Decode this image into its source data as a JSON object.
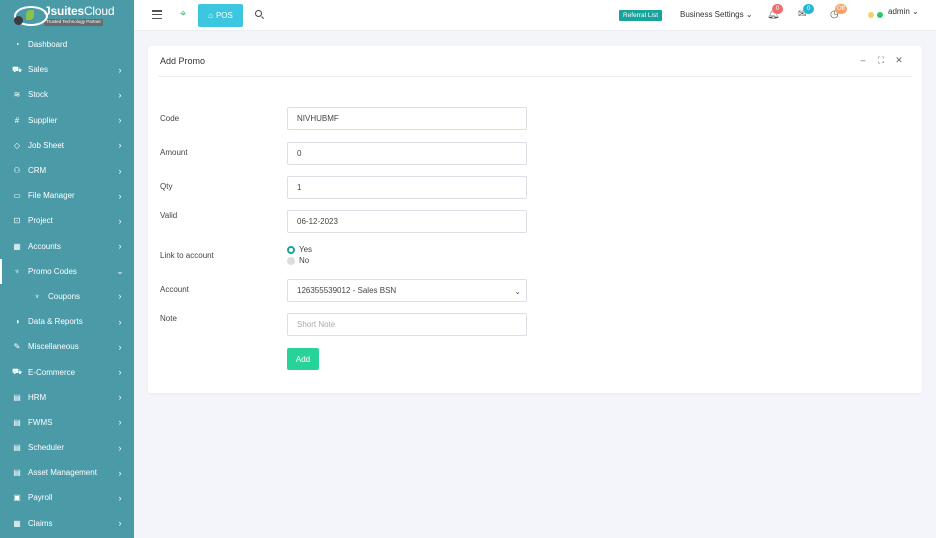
{
  "brand": {
    "name_bold": "Jsuites",
    "name_rest": "Cloud",
    "tagline": "Trusted Technology Partner"
  },
  "sidebar": {
    "items": [
      {
        "label": "Dashboard",
        "icon": "dashboard-icon",
        "has_chevron": false
      },
      {
        "label": "Sales",
        "icon": "cart-icon",
        "has_chevron": true
      },
      {
        "label": "Stock",
        "icon": "layers-icon",
        "has_chevron": true
      },
      {
        "label": "Supplier",
        "icon": "hash-icon",
        "has_chevron": true
      },
      {
        "label": "Job Sheet",
        "icon": "diamond-icon",
        "has_chevron": true
      },
      {
        "label": "CRM",
        "icon": "users-icon",
        "has_chevron": true
      },
      {
        "label": "File Manager",
        "icon": "folder-icon",
        "has_chevron": true
      },
      {
        "label": "Project",
        "icon": "briefcase-icon",
        "has_chevron": true
      },
      {
        "label": "Accounts",
        "icon": "calculator-icon",
        "has_chevron": true
      },
      {
        "label": "Promo Codes",
        "icon": "trophy-icon",
        "has_chevron": true,
        "expanded": true
      },
      {
        "label": "Coupons",
        "icon": "trophy-icon",
        "has_chevron": true,
        "sub": true
      },
      {
        "label": "Data & Reports",
        "icon": "pie-chart-icon",
        "has_chevron": true
      },
      {
        "label": "Miscellaneous",
        "icon": "edit-icon",
        "has_chevron": true
      },
      {
        "label": "E-Commerce",
        "icon": "cart-icon",
        "has_chevron": true
      },
      {
        "label": "HRM",
        "icon": "file-icon",
        "has_chevron": true
      },
      {
        "label": "FWMS",
        "icon": "file-icon",
        "has_chevron": true
      },
      {
        "label": "Scheduler",
        "icon": "file-icon",
        "has_chevron": true
      },
      {
        "label": "Asset Management",
        "icon": "file-icon",
        "has_chevron": true
      },
      {
        "label": "Payroll",
        "icon": "money-icon",
        "has_chevron": true
      },
      {
        "label": "Claims",
        "icon": "calculator-icon",
        "has_chevron": true
      }
    ]
  },
  "topbar": {
    "pos_label": "POS",
    "referral_label": "Referral List",
    "business_label": "Business Settings",
    "notifications_count": "0",
    "messages_count": "0",
    "clock_badge": "Off",
    "user_name": "admin"
  },
  "card": {
    "title": "Add Promo",
    "fields": {
      "code": {
        "label": "Code",
        "value": "NIVHUBMF"
      },
      "amount": {
        "label": "Amount",
        "value": "0"
      },
      "qty": {
        "label": "Qty",
        "value": "1"
      },
      "valid": {
        "label": "Valid",
        "value": "06-12-2023"
      },
      "link": {
        "label": "Link to account",
        "option_yes": "Yes",
        "option_no": "No",
        "selected": "Yes"
      },
      "account": {
        "label": "Account",
        "value": "126355539012 - Sales BSN"
      },
      "note": {
        "label": "Note",
        "placeholder": "Short Note"
      }
    },
    "add_label": "Add"
  },
  "colors": {
    "sidebar": "#4a9aa8",
    "accent": "#1aa39a",
    "pos": "#3cc6e0",
    "add": "#28d39a"
  }
}
